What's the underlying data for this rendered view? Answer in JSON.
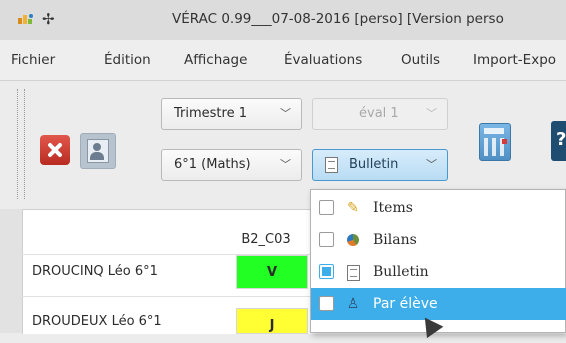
{
  "window": {
    "title": "VÉRAC  0.99___07-08-2016  [perso]  [Version perso",
    "icons": [
      "app-icon",
      "pin-icon"
    ]
  },
  "menubar": {
    "items": [
      "Fichier",
      "Édition",
      "Affichage",
      "Évaluations",
      "Outils",
      "Import-Expo"
    ]
  },
  "toolbar": {
    "period_select": "Trimestre 1",
    "eval_select": "éval 1",
    "class_select": "6°1 (Maths)",
    "view_select": "Bulletin"
  },
  "view_menu": {
    "items": [
      {
        "label": "Items",
        "checked": false,
        "highlighted": false,
        "icon": "pencil-icon"
      },
      {
        "label": "Bilans",
        "checked": false,
        "highlighted": false,
        "icon": "pie-chart-icon"
      },
      {
        "label": "Bulletin",
        "checked": true,
        "highlighted": false,
        "icon": "document-icon"
      },
      {
        "label": "Par élève",
        "checked": false,
        "highlighted": true,
        "icon": "person-icon"
      }
    ]
  },
  "table": {
    "column_header": "B2_C03",
    "rows": [
      {
        "name": "DROUCINQ Léo 6°1",
        "value": "V",
        "color": "#22ff22"
      },
      {
        "name": "DROUDEUX Léo 6°1",
        "value": "J",
        "color": "#ffff33"
      }
    ]
  }
}
